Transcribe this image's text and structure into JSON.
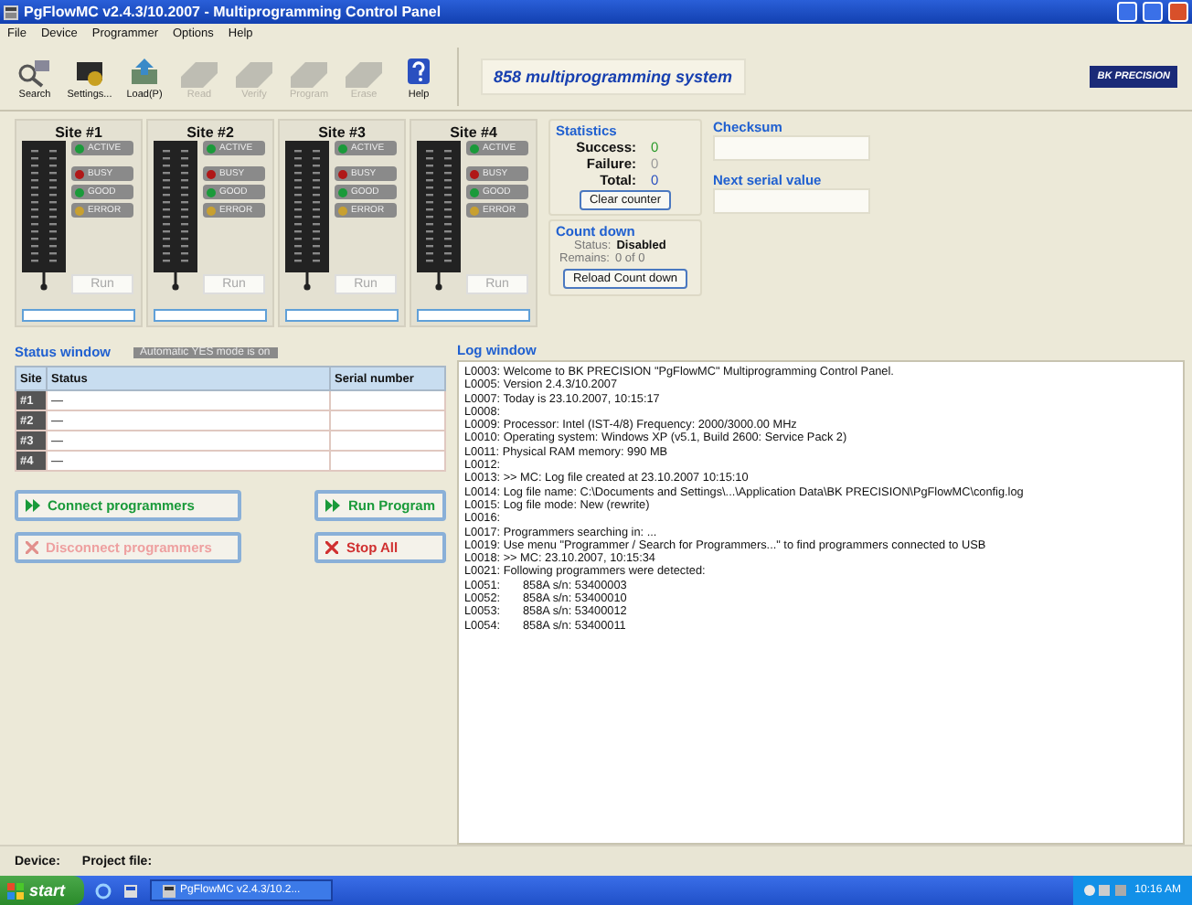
{
  "window": {
    "title": "PgFlowMC v2.4.3/10.2007 - Multiprogramming Control Panel"
  },
  "menu": [
    "File",
    "Device",
    "Programmer",
    "Options",
    "Help"
  ],
  "toolbar": [
    {
      "label": "Search",
      "disabled": false
    },
    {
      "label": "Settings...",
      "disabled": false
    },
    {
      "label": "Load(P)",
      "disabled": false
    },
    {
      "label": "Read",
      "disabled": true
    },
    {
      "label": "Verify",
      "disabled": true
    },
    {
      "label": "Program",
      "disabled": true
    },
    {
      "label": "Erase",
      "disabled": true
    },
    {
      "label": "Help",
      "disabled": false
    }
  ],
  "banner": "858 multiprogramming system",
  "logo": "BK PRECISION",
  "sites": [
    {
      "title": "Site #1",
      "leds": [
        {
          "label": "ACTIVE",
          "color": "#1a9a3a"
        },
        {
          "label": "BUSY",
          "color": "#b01818"
        },
        {
          "label": "GOOD",
          "color": "#1a9a3a"
        },
        {
          "label": "ERROR",
          "color": "#c8a030"
        }
      ],
      "run": "Run",
      "level": 0
    },
    {
      "title": "Site #2",
      "leds": [
        {
          "label": "ACTIVE",
          "color": "#1a9a3a"
        },
        {
          "label": "BUSY",
          "color": "#b01818"
        },
        {
          "label": "GOOD",
          "color": "#1a9a3a"
        },
        {
          "label": "ERROR",
          "color": "#c8a030"
        }
      ],
      "run": "Run",
      "level": 0
    },
    {
      "title": "Site #3",
      "leds": [
        {
          "label": "ACTIVE",
          "color": "#1a9a3a"
        },
        {
          "label": "BUSY",
          "color": "#b01818"
        },
        {
          "label": "GOOD",
          "color": "#1a9a3a"
        },
        {
          "label": "ERROR",
          "color": "#c8a030"
        }
      ],
      "run": "Run",
      "level": 0
    },
    {
      "title": "Site #4",
      "leds": [
        {
          "label": "ACTIVE",
          "color": "#1a9a3a"
        },
        {
          "label": "BUSY",
          "color": "#b01818"
        },
        {
          "label": "GOOD",
          "color": "#1a9a3a"
        },
        {
          "label": "ERROR",
          "color": "#c8a030"
        }
      ],
      "run": "Run",
      "level": 0
    }
  ],
  "statistics": {
    "title": "Statistics",
    "rows": [
      {
        "label": "Success:",
        "value": "0",
        "color": "#2a9a2a"
      },
      {
        "label": "Failure:",
        "value": "0",
        "color": "#9a9a9a"
      },
      {
        "label": "Total:",
        "value": "0",
        "color": "#2a50c0"
      }
    ],
    "button": "Clear counter"
  },
  "count_down": {
    "title": "Count down",
    "status_label": "Status:",
    "status": "Disabled",
    "remains_label": "Remains:",
    "remains": "0 of 0",
    "button": "Reload Count down"
  },
  "checksum": {
    "title": "Checksum"
  },
  "next_serial": {
    "title": "Next serial value"
  },
  "status_window": {
    "title": "Status window",
    "badge": "Automatic YES mode is on",
    "columns": [
      "Site",
      "Status",
      "Serial number"
    ],
    "rows": [
      [
        "#1",
        "—",
        ""
      ],
      [
        "#2",
        "—",
        ""
      ],
      [
        "#3",
        "—",
        ""
      ],
      [
        "#4",
        "—",
        ""
      ]
    ]
  },
  "actions": [
    {
      "label": "Connect programmers",
      "kind": "go",
      "disabled": false
    },
    {
      "label": "Run Program",
      "kind": "go",
      "disabled": false
    },
    {
      "label": "Disconnect programmers",
      "kind": "stop",
      "disabled": true
    },
    {
      "label": "Stop All",
      "kind": "stop",
      "disabled": false
    }
  ],
  "log_window": {
    "title": "Log window",
    "lines": [
      "L0003: Welcome to BK PRECISION \"PgFlowMC\" Multiprogramming Control Panel.",
      "L0005: Version 2.4.3/10.2007",
      "L0007: Today is 23.10.2007, 10:15:17",
      "L0008:",
      "L0009: Processor: Intel (IST-4/8) Frequency: 2000/3000.00 MHz",
      "L0010: Operating system: Windows XP (v5.1, Build 2600: Service Pack 2)",
      "L0011: Physical RAM memory: 990 MB",
      "L0012:",
      "L0013: >> MC: Log file created at 23.10.2007 10:15:10",
      "L0014: Log file name: C:\\Documents and Settings\\...\\Application Data\\BK PRECISION\\PgFlowMC\\config.log",
      "L0015: Log file mode: New (rewrite)",
      "L0016:",
      "L0017: Programmers searching in: ...",
      "L0019: Use menu \"Programmer / Search for Programmers...\" to find programmers connected to USB",
      "L0018: >> MC: 23.10.2007, 10:15:34",
      "L0021: Following programmers were detected:",
      "L0051:       858A s/n: 53400003",
      "L0052:       858A s/n: 53400010",
      "L0053:       858A s/n: 53400012",
      "L0054:       858A s/n: 53400011"
    ]
  },
  "status_bar": {
    "device_label": "Device:",
    "project_label": "Project file:"
  },
  "taskbar": {
    "start": "start",
    "task": "PgFlowMC v2.4.3/10.2...",
    "clock": "10:16 AM"
  }
}
